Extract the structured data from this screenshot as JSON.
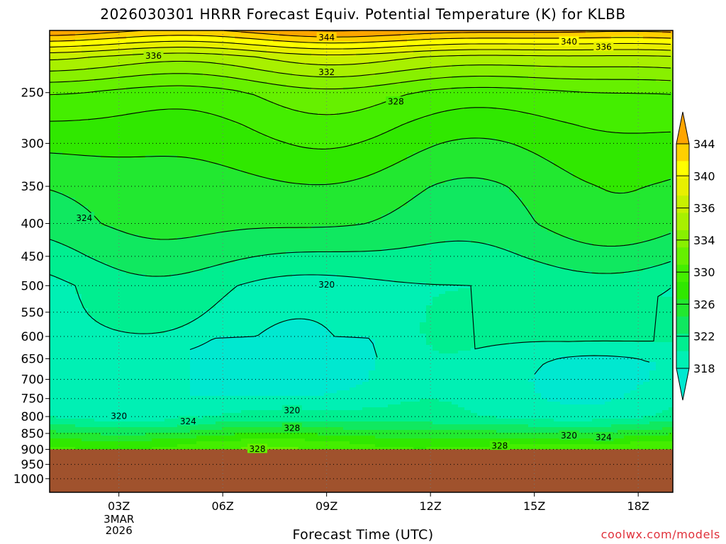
{
  "header": {
    "title": "2026030301 HRRR Forecast Equiv. Potential Temperature (K) for KLBB"
  },
  "footer": {
    "xlabel": "Forecast Time (UTC)",
    "credit": "coolwx.com/models"
  },
  "colors": {
    "terrain": "#a0522d",
    "contour_line": "#000000",
    "grid": "#000000",
    "credit": "#e0303a"
  },
  "chart_data": {
    "type": "heatmap",
    "title": "2026030301 HRRR Forecast Equiv. Potential Temperature (K) for KLBB",
    "xlabel": "Forecast Time (UTC)",
    "ylabel": "",
    "x_ticks": [
      {
        "hour": 3,
        "label": "03Z",
        "sub": [
          "3MAR",
          "2026"
        ]
      },
      {
        "hour": 6,
        "label": "06Z",
        "sub": []
      },
      {
        "hour": 9,
        "label": "09Z",
        "sub": []
      },
      {
        "hour": 12,
        "label": "12Z",
        "sub": []
      },
      {
        "hour": 15,
        "label": "15Z",
        "sub": []
      },
      {
        "hour": 18,
        "label": "18Z",
        "sub": []
      }
    ],
    "xlim": [
      1,
      19
    ],
    "y_ticks": [
      250,
      300,
      350,
      400,
      450,
      500,
      550,
      600,
      650,
      700,
      750,
      800,
      850,
      900,
      950,
      1000
    ],
    "y_scale": "log-pressure",
    "ylim_hPa": [
      200,
      1050
    ],
    "surface_pressure_hPa": 900,
    "colorbar": {
      "labels": [
        "344",
        "340",
        "336",
        "334",
        "330",
        "326",
        "322",
        "318"
      ],
      "bands": [
        {
          "from": 344,
          "to": 348,
          "color": "#ffa500"
        },
        {
          "from": 342,
          "to": 344,
          "color": "#ffd000"
        },
        {
          "from": 340,
          "to": 342,
          "color": "#ffff00"
        },
        {
          "from": 338,
          "to": 340,
          "color": "#e8f000"
        },
        {
          "from": 336,
          "to": 338,
          "color": "#c8f000"
        },
        {
          "from": 334,
          "to": 336,
          "color": "#a8f000"
        },
        {
          "from": 332,
          "to": 334,
          "color": "#88f000"
        },
        {
          "from": 330,
          "to": 332,
          "color": "#66f000"
        },
        {
          "from": 328,
          "to": 330,
          "color": "#44ee00"
        },
        {
          "from": 326,
          "to": 328,
          "color": "#30e800"
        },
        {
          "from": 324,
          "to": 326,
          "color": "#22e830"
        },
        {
          "from": 322,
          "to": 324,
          "color": "#10e860"
        },
        {
          "from": 320,
          "to": 322,
          "color": "#00ee90"
        },
        {
          "from": 318,
          "to": 320,
          "color": "#00f0b4"
        },
        {
          "from": 314,
          "to": 318,
          "color": "#00e8d0"
        }
      ]
    },
    "theta_e_profile_K": {
      "pressure_hPa": [
        200,
        220,
        250,
        280,
        300,
        350,
        400,
        450,
        500,
        550,
        600,
        650,
        700,
        750,
        800,
        850,
        880,
        900
      ],
      "theta_e": [
        345,
        336,
        330,
        328,
        327,
        325,
        324,
        322,
        320,
        319.5,
        319,
        318.5,
        318.5,
        319,
        320,
        325,
        328,
        329
      ]
    },
    "contour_labels": [
      {
        "text": "344",
        "hour": 9,
        "p": 205
      },
      {
        "text": "340",
        "hour": 16,
        "p": 208
      },
      {
        "text": "336",
        "hour": 17,
        "p": 212
      },
      {
        "text": "336",
        "hour": 4,
        "p": 219
      },
      {
        "text": "332",
        "hour": 9,
        "p": 232
      },
      {
        "text": "328",
        "hour": 11,
        "p": 258
      },
      {
        "text": "324",
        "hour": 2,
        "p": 392
      },
      {
        "text": "320",
        "hour": 9,
        "p": 498
      },
      {
        "text": "320",
        "hour": 3,
        "p": 798
      },
      {
        "text": "320",
        "hour": 8,
        "p": 782
      },
      {
        "text": "324",
        "hour": 5,
        "p": 813
      },
      {
        "text": "328",
        "hour": 8,
        "p": 833
      },
      {
        "text": "328",
        "hour": 7,
        "p": 898
      },
      {
        "text": "328",
        "hour": 14,
        "p": 888
      },
      {
        "text": "320",
        "hour": 16,
        "p": 856
      },
      {
        "text": "324",
        "hour": 17,
        "p": 861
      }
    ]
  }
}
